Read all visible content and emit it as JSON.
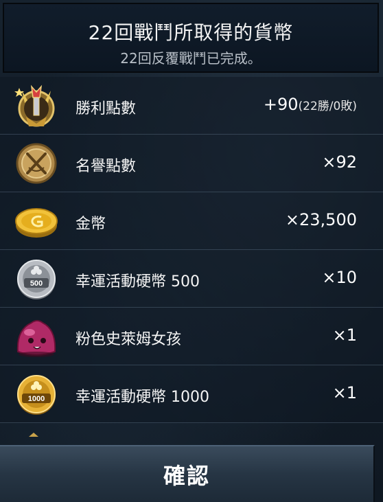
{
  "header": {
    "title": "22回戰鬥所取得的貨幣",
    "subtitle": "22回反覆戰鬥已完成。"
  },
  "rewards": [
    {
      "icon": "victory-crest-icon",
      "name": "勝利點數",
      "amount": "+90",
      "record": "(22勝/0敗)"
    },
    {
      "icon": "honor-medal-icon",
      "name": "名譽點數",
      "amount": "×92"
    },
    {
      "icon": "gold-coin-icon",
      "name": "金幣",
      "amount": "×23,500"
    },
    {
      "icon": "lucky-coin-500-icon",
      "name": "幸運活動硬幣 500",
      "amount": "×10"
    },
    {
      "icon": "pink-slime-icon",
      "name": "粉色史萊姆女孩",
      "amount": "×1"
    },
    {
      "icon": "lucky-coin-1000-icon",
      "name": "幸運活動硬幣 1000",
      "amount": "×1"
    }
  ],
  "coin_labels": {
    "coin500": "500",
    "coin1000": "1000"
  },
  "confirm_label": "確認",
  "colors": {
    "gold": "#d9a93a",
    "silver": "#b8bcc2",
    "pink": "#c0306e"
  }
}
